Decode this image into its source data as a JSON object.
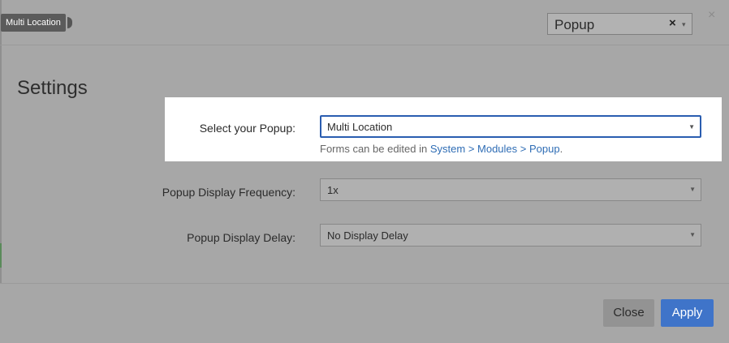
{
  "tooltip": {
    "text": "Multi Location"
  },
  "header": {
    "type_select": {
      "value": "Popup",
      "clear_glyph": "×",
      "arrow_glyph": "▾"
    },
    "close_glyph": "×"
  },
  "settings": {
    "title": "Settings",
    "select_popup": {
      "label": "Select your Popup:",
      "value": "Multi Location"
    },
    "hint": {
      "prefix": "Forms can be edited in ",
      "link": "System > Modules > Popup",
      "suffix": "."
    },
    "frequency": {
      "label": "Popup Display Frequency:",
      "value": "1x"
    },
    "delay": {
      "label": "Popup Display Delay:",
      "value": "No Display Delay"
    }
  },
  "footer": {
    "close_label": "Close",
    "apply_label": "Apply"
  },
  "colors": {
    "accent": "#3f74c9",
    "link": "#2f6db5",
    "focus_border": "#2a5db0"
  }
}
